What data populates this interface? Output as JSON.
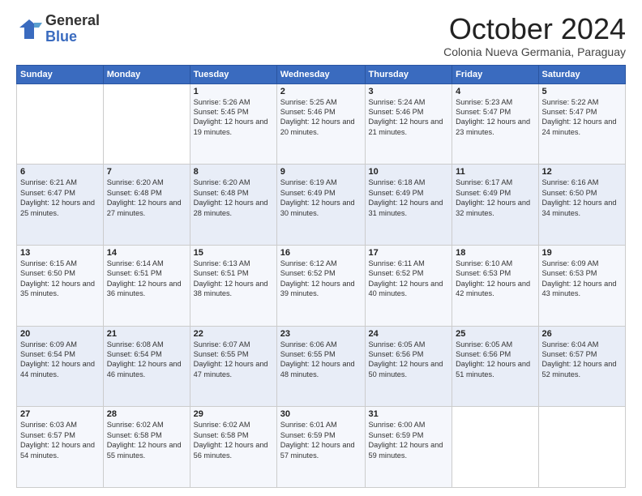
{
  "logo": {
    "general": "General",
    "blue": "Blue"
  },
  "header": {
    "title": "October 2024",
    "subtitle": "Colonia Nueva Germania, Paraguay"
  },
  "weekdays": [
    "Sunday",
    "Monday",
    "Tuesday",
    "Wednesday",
    "Thursday",
    "Friday",
    "Saturday"
  ],
  "weeks": [
    [
      {
        "day": "",
        "info": ""
      },
      {
        "day": "",
        "info": ""
      },
      {
        "day": "1",
        "info": "Sunrise: 5:26 AM\nSunset: 5:45 PM\nDaylight: 12 hours and 19 minutes."
      },
      {
        "day": "2",
        "info": "Sunrise: 5:25 AM\nSunset: 5:46 PM\nDaylight: 12 hours and 20 minutes."
      },
      {
        "day": "3",
        "info": "Sunrise: 5:24 AM\nSunset: 5:46 PM\nDaylight: 12 hours and 21 minutes."
      },
      {
        "day": "4",
        "info": "Sunrise: 5:23 AM\nSunset: 5:47 PM\nDaylight: 12 hours and 23 minutes."
      },
      {
        "day": "5",
        "info": "Sunrise: 5:22 AM\nSunset: 5:47 PM\nDaylight: 12 hours and 24 minutes."
      }
    ],
    [
      {
        "day": "6",
        "info": "Sunrise: 6:21 AM\nSunset: 6:47 PM\nDaylight: 12 hours and 25 minutes."
      },
      {
        "day": "7",
        "info": "Sunrise: 6:20 AM\nSunset: 6:48 PM\nDaylight: 12 hours and 27 minutes."
      },
      {
        "day": "8",
        "info": "Sunrise: 6:20 AM\nSunset: 6:48 PM\nDaylight: 12 hours and 28 minutes."
      },
      {
        "day": "9",
        "info": "Sunrise: 6:19 AM\nSunset: 6:49 PM\nDaylight: 12 hours and 30 minutes."
      },
      {
        "day": "10",
        "info": "Sunrise: 6:18 AM\nSunset: 6:49 PM\nDaylight: 12 hours and 31 minutes."
      },
      {
        "day": "11",
        "info": "Sunrise: 6:17 AM\nSunset: 6:49 PM\nDaylight: 12 hours and 32 minutes."
      },
      {
        "day": "12",
        "info": "Sunrise: 6:16 AM\nSunset: 6:50 PM\nDaylight: 12 hours and 34 minutes."
      }
    ],
    [
      {
        "day": "13",
        "info": "Sunrise: 6:15 AM\nSunset: 6:50 PM\nDaylight: 12 hours and 35 minutes."
      },
      {
        "day": "14",
        "info": "Sunrise: 6:14 AM\nSunset: 6:51 PM\nDaylight: 12 hours and 36 minutes."
      },
      {
        "day": "15",
        "info": "Sunrise: 6:13 AM\nSunset: 6:51 PM\nDaylight: 12 hours and 38 minutes."
      },
      {
        "day": "16",
        "info": "Sunrise: 6:12 AM\nSunset: 6:52 PM\nDaylight: 12 hours and 39 minutes."
      },
      {
        "day": "17",
        "info": "Sunrise: 6:11 AM\nSunset: 6:52 PM\nDaylight: 12 hours and 40 minutes."
      },
      {
        "day": "18",
        "info": "Sunrise: 6:10 AM\nSunset: 6:53 PM\nDaylight: 12 hours and 42 minutes."
      },
      {
        "day": "19",
        "info": "Sunrise: 6:09 AM\nSunset: 6:53 PM\nDaylight: 12 hours and 43 minutes."
      }
    ],
    [
      {
        "day": "20",
        "info": "Sunrise: 6:09 AM\nSunset: 6:54 PM\nDaylight: 12 hours and 44 minutes."
      },
      {
        "day": "21",
        "info": "Sunrise: 6:08 AM\nSunset: 6:54 PM\nDaylight: 12 hours and 46 minutes."
      },
      {
        "day": "22",
        "info": "Sunrise: 6:07 AM\nSunset: 6:55 PM\nDaylight: 12 hours and 47 minutes."
      },
      {
        "day": "23",
        "info": "Sunrise: 6:06 AM\nSunset: 6:55 PM\nDaylight: 12 hours and 48 minutes."
      },
      {
        "day": "24",
        "info": "Sunrise: 6:05 AM\nSunset: 6:56 PM\nDaylight: 12 hours and 50 minutes."
      },
      {
        "day": "25",
        "info": "Sunrise: 6:05 AM\nSunset: 6:56 PM\nDaylight: 12 hours and 51 minutes."
      },
      {
        "day": "26",
        "info": "Sunrise: 6:04 AM\nSunset: 6:57 PM\nDaylight: 12 hours and 52 minutes."
      }
    ],
    [
      {
        "day": "27",
        "info": "Sunrise: 6:03 AM\nSunset: 6:57 PM\nDaylight: 12 hours and 54 minutes."
      },
      {
        "day": "28",
        "info": "Sunrise: 6:02 AM\nSunset: 6:58 PM\nDaylight: 12 hours and 55 minutes."
      },
      {
        "day": "29",
        "info": "Sunrise: 6:02 AM\nSunset: 6:58 PM\nDaylight: 12 hours and 56 minutes."
      },
      {
        "day": "30",
        "info": "Sunrise: 6:01 AM\nSunset: 6:59 PM\nDaylight: 12 hours and 57 minutes."
      },
      {
        "day": "31",
        "info": "Sunrise: 6:00 AM\nSunset: 6:59 PM\nDaylight: 12 hours and 59 minutes."
      },
      {
        "day": "",
        "info": ""
      },
      {
        "day": "",
        "info": ""
      }
    ]
  ]
}
